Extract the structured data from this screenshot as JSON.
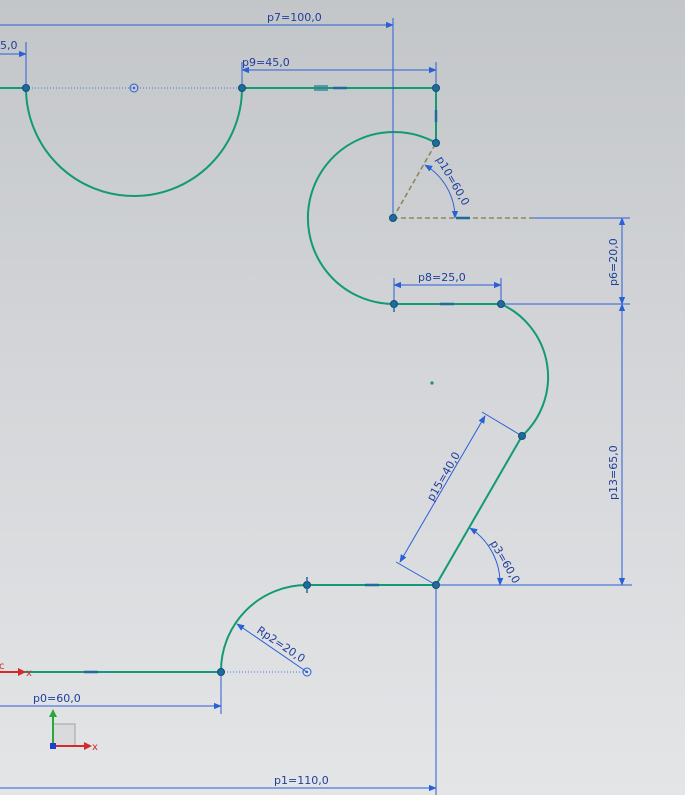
{
  "dimensions": {
    "p7": "p7=100,0",
    "p9": "p9=45,0",
    "p5_partial": "5,0",
    "p10": "p10=60,0",
    "p6": "p6=20,0",
    "p8": "p8=25,0",
    "p13": "p13=65,0",
    "p15": "p15=40,0",
    "p3": "p3=60,0",
    "rp2": "Rp2=20,0",
    "p0": "p0=60,0",
    "p1": "p1=110,0"
  },
  "axes": {
    "x_label": "x",
    "y_label": "",
    "origin_x_label": "x",
    "origin_c_label": "c"
  },
  "colors": {
    "curve": "#129a74",
    "dimension": "#2a5fd6",
    "point": "#1f6b9a",
    "x_axis": "#d42a2a",
    "y_axis": "#2aa83a"
  }
}
